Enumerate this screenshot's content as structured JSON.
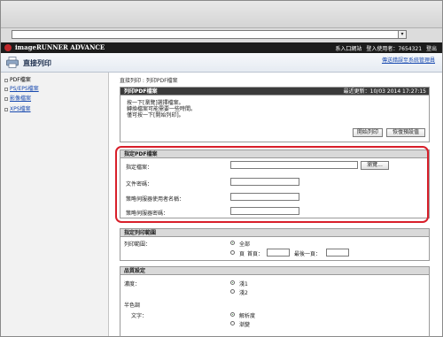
{
  "brand": {
    "name": "imageRUNNER ADVANCE",
    "login_link": "系入口網站",
    "login_user": "登入使用者：7654321",
    "logout_link": "登出"
  },
  "header": {
    "title": "直接列印",
    "mail_link": "傳送錯誤至系統管理員"
  },
  "sidebar": {
    "items": [
      {
        "label": "PDF檔案"
      },
      {
        "label": "PS/EPS檔案"
      },
      {
        "label": "影像檔案"
      },
      {
        "label": "XPS檔案"
      }
    ]
  },
  "breadcrumb": "直接列印 : 列印PDF檔案",
  "print_section": {
    "title": "列印PDF檔案",
    "updated": "最近更新：10/03 2014 17:27:15",
    "instructions": [
      "按一下[瀏覽]選擇檔案。",
      "轉換檔案可能需要一些時間。",
      "僅可按一下[開始列印]。"
    ],
    "start_button": "開始列印",
    "restore_button": "恢復預設值"
  },
  "file_section": {
    "title": "指定PDF檔案",
    "fields": [
      {
        "label": "指定檔案：",
        "value": ""
      },
      {
        "label": "文件密碼：",
        "value": ""
      },
      {
        "label": "策略伺服器使用者名稱：",
        "value": ""
      },
      {
        "label": "策略伺服器密碼：",
        "value": ""
      }
    ],
    "browse_button": "瀏覽..."
  },
  "range_section": {
    "title": "指定列印範圍",
    "label": "列印範圍：",
    "option_all": "全部",
    "option_pages": "頁",
    "first_page_label": "首頁：",
    "last_page_label": "最後一頁："
  },
  "quality_section": {
    "title": "品質設定",
    "density_label": "濃度：",
    "density_options": [
      "淺1",
      "淺2"
    ],
    "halftone_label": "半色調",
    "text_label": "文字：",
    "text_options": [
      "解析度",
      "漸變"
    ]
  },
  "colors": {
    "highlight": "#d81f2a",
    "brand_bar": "#1c1c1c",
    "link": "#1a4bb0"
  }
}
